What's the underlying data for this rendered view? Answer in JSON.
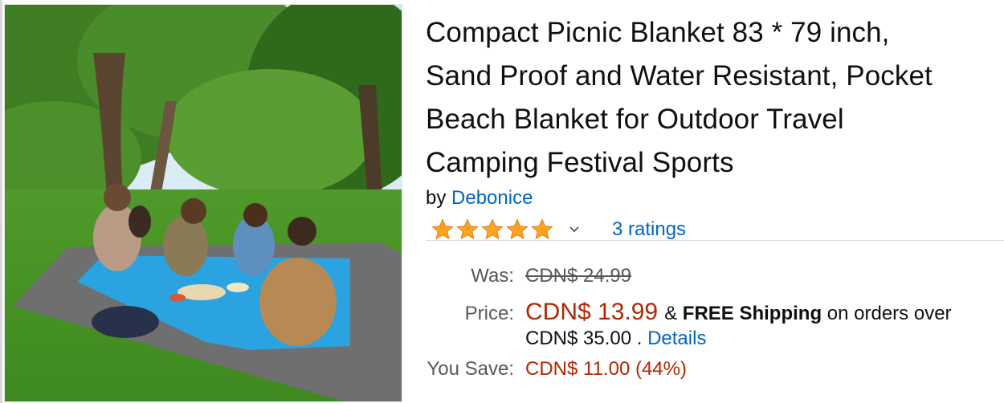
{
  "product": {
    "title": "Compact Picnic Blanket 83 * 79 inch, Sand Proof and Water Resistant, Pocket Beach Blanket for Outdoor Travel Camping Festival Sports",
    "title_lines": [
      "Compact Picnic Blanket 83 * 79 inch,",
      "Sand Proof and Water Resistant, Pocket",
      "Beach Blanket for Outdoor Travel",
      "Camping Festival Sports"
    ],
    "by_label": "by",
    "brand": "Debonice",
    "rating_stars": 5,
    "ratings_label": "3 ratings"
  },
  "pricing": {
    "was_label": "Was:",
    "was_value": "CDN$ 24.99",
    "price_label": "Price:",
    "price_value": "CDN$ 13.99",
    "shipping_prefix": "&",
    "shipping_bold": "FREE Shipping",
    "shipping_suffix": "on orders over",
    "shipping_threshold": "CDN$ 35.00 .",
    "details_link": "Details",
    "save_label": "You Save:",
    "save_value": "CDN$ 11.00 (44%)"
  },
  "colors": {
    "link": "#0066c0",
    "price": "#b12704",
    "star": "#ffa41c",
    "blanket_blue": "#2aa3e0",
    "blanket_gray": "#6f6f6f"
  }
}
